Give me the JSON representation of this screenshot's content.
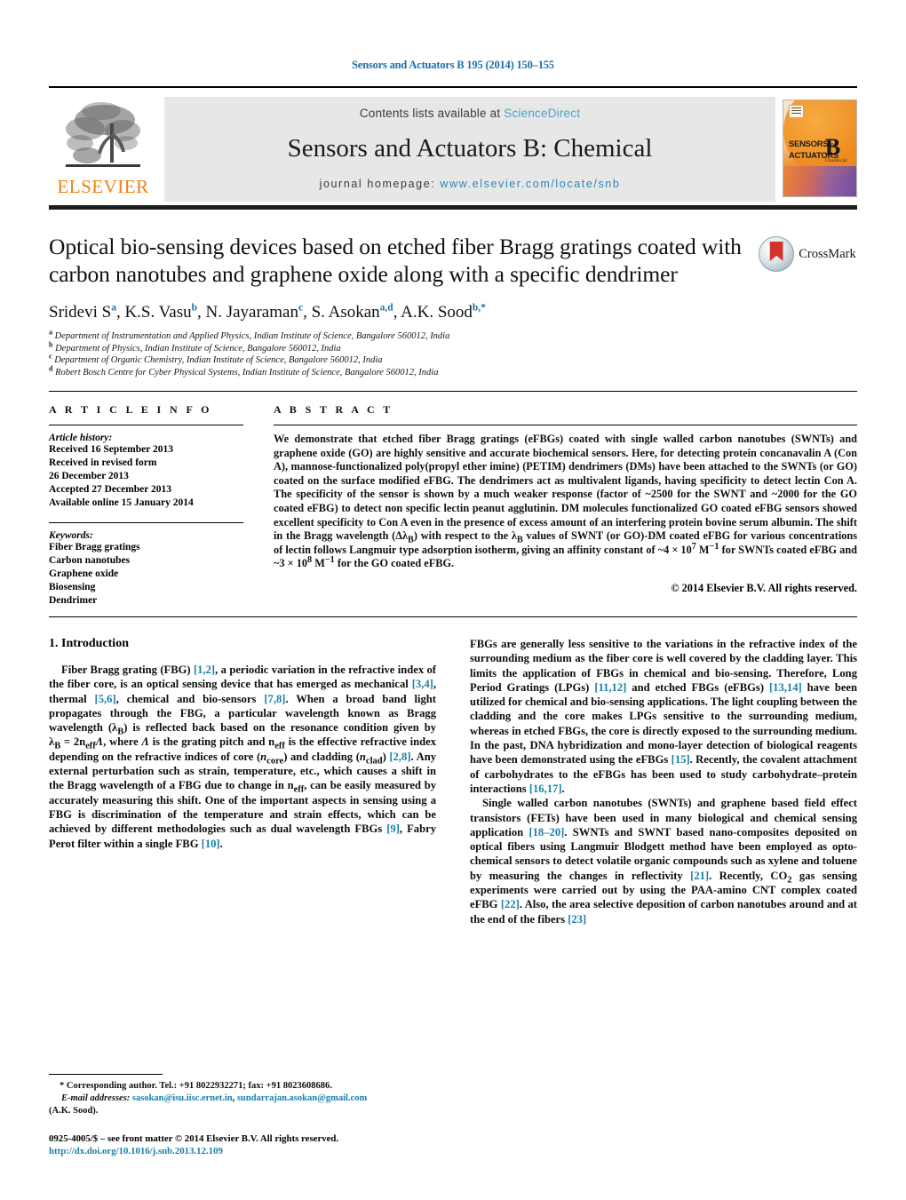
{
  "running_head": "Sensors and Actuators B 195 (2014) 150–155",
  "masthead": {
    "contents_prefix": "Contents lists available at ",
    "sciencedirect": "ScienceDirect",
    "journal_title": "Sensors and Actuators B: Chemical",
    "homepage_prefix": "journal homepage:",
    "homepage_url": "www.elsevier.com/locate/snb",
    "publisher_logo_text": "ELSEVIER",
    "cover_line1": "SENSORS",
    "cover_line2": "ACTUATORS",
    "cover_and": "and",
    "cover_letter": "B",
    "cover_sub": "Chemical",
    "accent_orange": "#f08010",
    "link_blue": "#2b86b8",
    "sd_blue": "#4aa3c7"
  },
  "crossmark": {
    "label": "CrossMark"
  },
  "article": {
    "title": "Optical bio-sensing devices based on etched fiber Bragg gratings coated with carbon nanotubes and graphene oxide along with a specific dendrimer",
    "authors_plain": "Sridevi S a, K.S. Vasu b, N. Jayaraman c, S. Asokan a,d, A.K. Sood b,*",
    "authors": [
      {
        "name": "Sridevi S",
        "sup": "a"
      },
      {
        "name": "K.S. Vasu",
        "sup": "b"
      },
      {
        "name": "N. Jayaraman",
        "sup": "c"
      },
      {
        "name": "S. Asokan",
        "sup": "a,d"
      },
      {
        "name": "A.K. Sood",
        "sup": "b,*"
      }
    ],
    "affiliations": [
      {
        "key": "a",
        "text": "Department of Instrumentation and Applied Physics, Indian Institute of Science, Bangalore 560012, India"
      },
      {
        "key": "b",
        "text": "Department of Physics, Indian Institute of Science, Bangalore 560012, India"
      },
      {
        "key": "c",
        "text": "Department of Organic Chemistry, Indian Institute of Science, Bangalore 560012, India"
      },
      {
        "key": "d",
        "text": "Robert Bosch Centre for Cyber Physical Systems, Indian Institute of Science, Bangalore 560012, India"
      }
    ]
  },
  "article_info": {
    "heading": "A R T I C L E   I N F O",
    "history_title": "Article history:",
    "history": [
      "Received 16 September 2013",
      "Received in revised form",
      "26 December 2013",
      "Accepted 27 December 2013",
      "Available online 15 January 2014"
    ],
    "keywords_title": "Keywords:",
    "keywords": [
      "Fiber Bragg gratings",
      "Carbon nanotubes",
      "Graphene oxide",
      "Biosensing",
      "Dendrimer"
    ]
  },
  "abstract": {
    "heading": "A B S T R A C T",
    "text": "We demonstrate that etched fiber Bragg gratings (eFBGs) coated with single walled carbon nanotubes (SWNTs) and graphene oxide (GO) are highly sensitive and accurate biochemical sensors. Here, for detecting protein concanavalin A (Con A), mannose-functionalized poly(propyl ether imine) (PETIM) dendrimers (DMs) have been attached to the SWNTs (or GO) coated on the surface modified eFBG. The dendrimers act as multivalent ligands, having specificity to detect lectin Con A. The specificity of the sensor is shown by a much weaker response (factor of ~2500 for the SWNT and ~2000 for the GO coated eFBG) to detect non specific lectin peanut agglutinin. DM molecules functionalized GO coated eFBG sensors showed excellent specificity to Con A even in the presence of excess amount of an interfering protein bovine serum albumin. The shift in the Bragg wavelength (Δλ_B) with respect to the λ_B values of SWNT (or GO)-DM coated eFBG for various concentrations of lectin follows Langmuir type adsorption isotherm, giving an affinity constant of ~4 × 10^7 M^−1 for SWNTs coated eFBG and ~3 × 10^8 M^−1 for the GO coated eFBG.",
    "copyright": "© 2014 Elsevier B.V. All rights reserved."
  },
  "introduction": {
    "heading": "1.  Introduction",
    "para1": "Fiber Bragg grating (FBG) [1,2], a periodic variation in the refractive index of the fiber core, is an optical sensing device that has emerged as mechanical [3,4], thermal [5,6], chemical and bio-sensors [7,8]. When a broad band light propagates through the FBG, a particular wavelength known as Bragg wavelength (λB) is reflected back based on the resonance condition given by λB = 2neffΛ, where Λ is the grating pitch and neff is the effective refractive index depending on the refractive indices of core (ncore) and cladding (nclad) [2,8]. Any external perturbation such as strain, temperature, etc., which causes a shift in the Bragg wavelength of a FBG due to change in neff, can be easily measured by accurately measuring this shift. One of the important aspects in sensing using a FBG is discrimination of the temperature and strain effects, which can be achieved by different methodologies such as dual wavelength FBGs [9], Fabry Perot filter within a single FBG [10].",
    "para2": "FBGs are generally less sensitive to the variations in the refractive index of the surrounding medium as the fiber core is well covered by the cladding layer. This limits the application of FBGs in chemical and bio-sensing. Therefore, Long Period Gratings (LPGs) [11,12] and etched FBGs (eFBGs) [13,14] have been utilized for chemical and bio-sensing applications. The light coupling between the cladding and the core makes LPGs sensitive to the surrounding medium, whereas in etched FBGs, the core is directly exposed to the surrounding medium. In the past, DNA hybridization and mono-layer detection of biological reagents have been demonstrated using the eFBGs [15]. Recently, the covalent attachment of carbohydrates to the eFBGs has been used to study carbohydrate–protein interactions [16,17].",
    "para3": "Single walled carbon nanotubes (SWNTs) and graphene based field effect transistors (FETs) have been used in many biological and chemical sensing application [18–20]. SWNTs and SWNT based nano-composites deposited on optical fibers using Langmuir Blodgett method have been employed as opto-chemical sensors to detect volatile organic compounds such as xylene and toluene by measuring the changes in reflectivity [21]. Recently, CO2 gas sensing experiments were carried out by using the PAA-amino CNT complex coated eFBG [22]. Also, the area selective deposition of carbon nanotubes around and at the end of the fibers [23]"
  },
  "footnote": {
    "corresponding": "* Corresponding author. Tel.: +91 8022932271; fax: +91 8023608686.",
    "email_label": "E-mail addresses:",
    "email1": "sasokan@isu.iisc.ernet.in",
    "email2": "sundarrajan.asokan@gmail.com",
    "email_tail": "(A.K. Sood).",
    "imprint": "0925-4005/$ – see front matter © 2014 Elsevier B.V. All rights reserved.",
    "doi": "http://dx.doi.org/10.1016/j.snb.2013.12.109"
  }
}
